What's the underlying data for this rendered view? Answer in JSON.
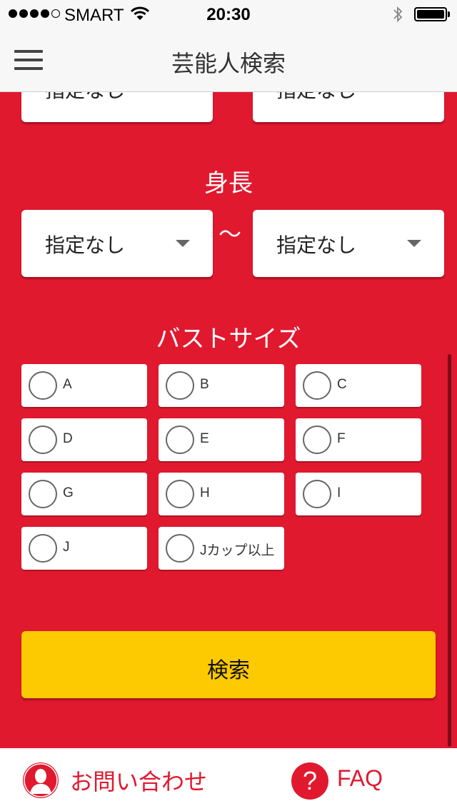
{
  "status_bar": {
    "carrier": "SMART",
    "time": "20:30"
  },
  "nav": {
    "title": "芸能人検索"
  },
  "age_range": {
    "min_value": "指定なし",
    "max_value": "指定なし"
  },
  "height_section": {
    "title": "身長",
    "min_value": "指定なし",
    "separator": "〜",
    "max_value": "指定なし"
  },
  "bust_section": {
    "title": "バストサイズ",
    "options": [
      "A",
      "B",
      "C",
      "D",
      "E",
      "F",
      "G",
      "H",
      "I",
      "J",
      "Jカップ以上"
    ]
  },
  "search_button": {
    "label": "検索"
  },
  "footer": {
    "contact_label": "お問い合わせ",
    "faq_label": "FAQ",
    "faq_icon_glyph": "?"
  },
  "colors": {
    "background": "#e0192f",
    "accent_button": "#fdc900",
    "bar": "#f7f7f7"
  }
}
